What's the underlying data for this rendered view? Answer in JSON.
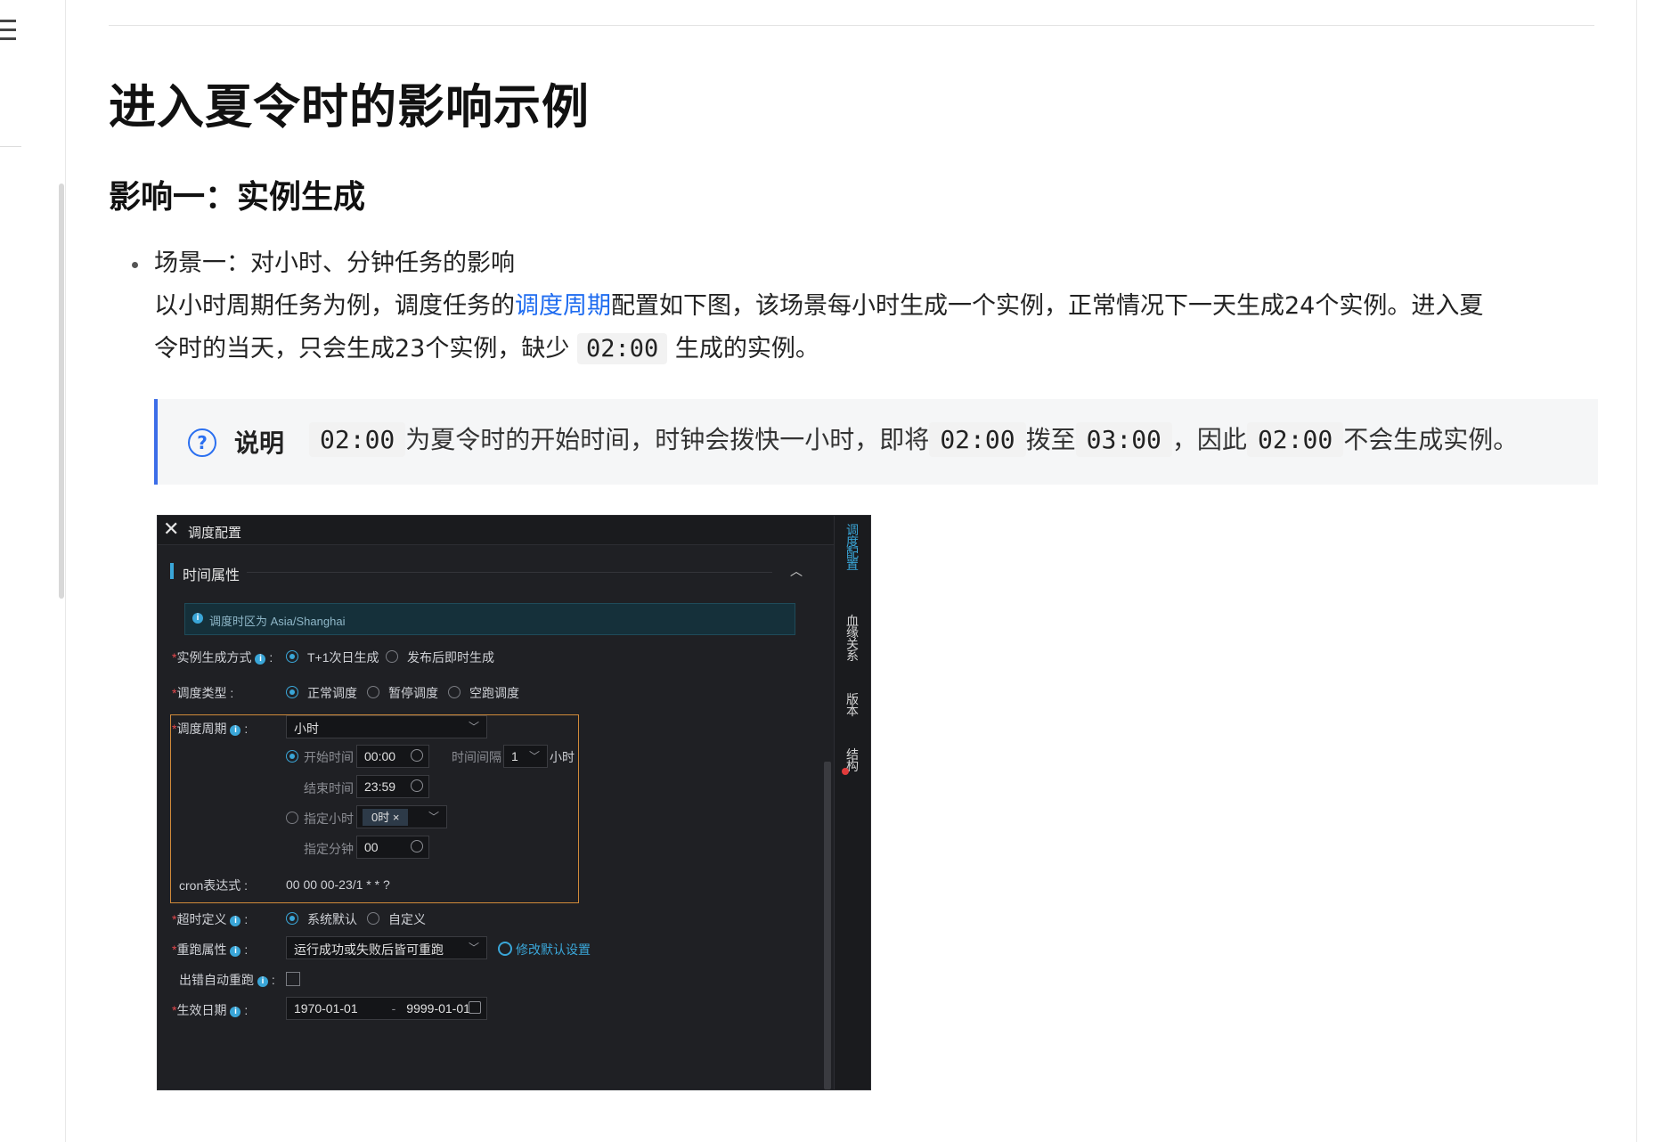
{
  "page": {
    "title": "进入夏令时的影响示例",
    "section_title": "影响一：实例生成",
    "scenario_title": "场景一：对小时、分钟任务的影响",
    "p2_before_link": "以小时周期任务为例，调度任务的",
    "p2_link": "调度周期",
    "p2_after_link": "配置如下图，该场景每小时生成一个实例，正常情况下一天生成24个实例。进入夏",
    "p3_before_code": "令时的当天，只会生成23个实例，缺少",
    "p3_code": "02:00",
    "p3_after_code": "生成的实例。"
  },
  "note": {
    "label": "说明",
    "code1": "02:00",
    "text1": "为夏令时的开始时间，时钟会拨快一小时，即将",
    "code2": "02:00",
    "text2": "拨至",
    "code3": "03:00",
    "text3": "，因此",
    "code4": "02:00",
    "text4": "不会生成实例。"
  },
  "shot": {
    "header_title": "调度配置",
    "side_tabs": [
      "调度配置",
      "血缘关系",
      "版本",
      "结构"
    ],
    "section": "时间属性",
    "timezone": "调度时区为 Asia/Shanghai",
    "instance_label": "实例生成方式",
    "instance_opt1": "T+1次日生成",
    "instance_opt2": "发布后即时生成",
    "type_label": "调度类型",
    "type_opt1": "正常调度",
    "type_opt2": "暂停调度",
    "type_opt3": "空跑调度",
    "cycle_label": "调度周期",
    "cycle_value": "小时",
    "start_label": "开始时间",
    "start_value": "00:00",
    "interval_label": "时间间隔",
    "interval_value": "1",
    "interval_unit": "小时",
    "end_label": "结束时间",
    "end_value": "23:59",
    "hour_label": "指定小时",
    "hour_tag": "0时",
    "minute_label": "指定分钟",
    "minute_value": "00",
    "cron_label": "cron表达式",
    "cron_value": "00 00 00-23/1 * * ?",
    "timeout_label": "超时定义",
    "timeout_opt1": "系统默认",
    "timeout_opt2": "自定义",
    "rerun_label": "重跑属性",
    "rerun_value": "运行成功或失败后皆可重跑",
    "rerun_link": "修改默认设置",
    "auto_rerun_label": "出错自动重跑",
    "date_label": "生效日期",
    "date_start": "1970-01-01",
    "date_sep": "-",
    "date_end": "9999-01-01"
  }
}
